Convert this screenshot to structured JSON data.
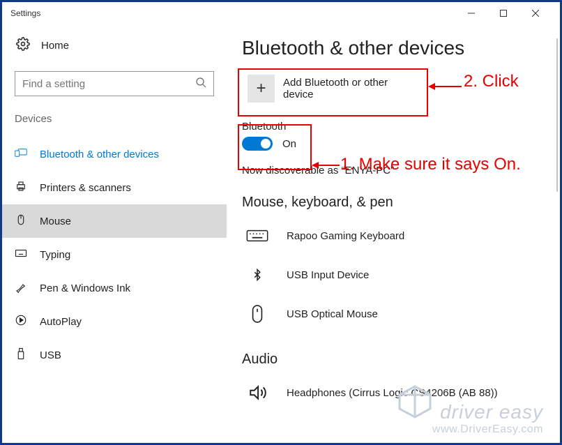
{
  "window": {
    "title": "Settings"
  },
  "sidebar": {
    "home": "Home",
    "search_placeholder": "Find a setting",
    "section": "Devices",
    "items": [
      {
        "label": "Bluetooth & other devices"
      },
      {
        "label": "Printers & scanners"
      },
      {
        "label": "Mouse"
      },
      {
        "label": "Typing"
      },
      {
        "label": "Pen & Windows Ink"
      },
      {
        "label": "AutoPlay"
      },
      {
        "label": "USB"
      }
    ]
  },
  "main": {
    "title": "Bluetooth & other devices",
    "add_label": "Add Bluetooth or other device",
    "bt_label": "Bluetooth",
    "bt_state": "On",
    "discoverable": "Now discoverable as “ENYA-PC”",
    "section1": "Mouse, keyboard, & pen",
    "devices1": [
      {
        "name": "Rapoo Gaming Keyboard"
      },
      {
        "name": "USB Input Device"
      },
      {
        "name": "USB Optical Mouse"
      }
    ],
    "section2": "Audio",
    "devices2": [
      {
        "name": "Headphones (Cirrus Logic CS4206B (AB 88))"
      }
    ]
  },
  "annotations": {
    "a1": "1. Make sure it says On.",
    "a2": "2. Click"
  },
  "watermark": {
    "line1": "driver easy",
    "line2": "www.DriverEasy.com"
  }
}
